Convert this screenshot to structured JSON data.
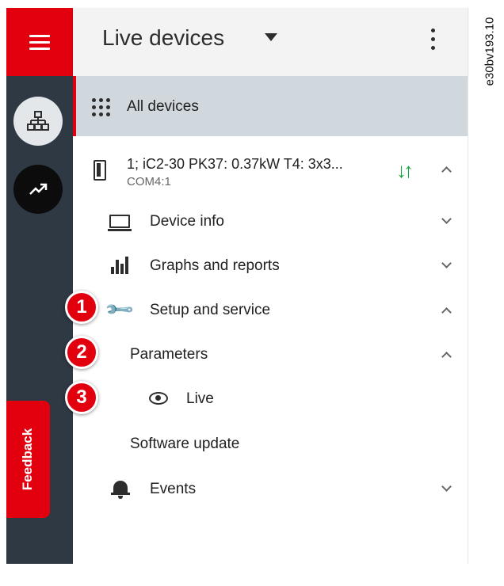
{
  "header": {
    "title": "Live devices"
  },
  "sidebar": {
    "items": [
      {
        "icon": "hamburger-menu-icon"
      },
      {
        "icon": "network-icon"
      },
      {
        "icon": "trend-icon"
      }
    ],
    "feedback_label": "Feedback"
  },
  "tree": {
    "all_devices": "All devices",
    "device": {
      "name": "1; iC2-30 PK37: 0.37kW T4: 3x3...",
      "port": "COM4:1",
      "status_icon": "transfer-arrows-icon",
      "status_color": "#14a83b"
    },
    "items": [
      {
        "label": "Device info",
        "icon": "laptop-icon",
        "expanded": false
      },
      {
        "label": "Graphs and reports",
        "icon": "bar-chart-icon",
        "expanded": false
      },
      {
        "label": "Setup and service",
        "icon": "wrench-icon",
        "expanded": true
      },
      {
        "label": "Parameters",
        "expanded": true
      },
      {
        "label": "Live",
        "icon": "eye-icon"
      },
      {
        "label": "Software update"
      },
      {
        "label": "Events",
        "icon": "bell-icon",
        "expanded": false
      }
    ]
  },
  "callouts": [
    "1",
    "2",
    "3"
  ],
  "figure_ref": "e30bv193.10",
  "colors": {
    "accent": "#e2000f",
    "rail": "#2f3944",
    "selected": "#d0d8de",
    "header": "#f3f3f3"
  }
}
